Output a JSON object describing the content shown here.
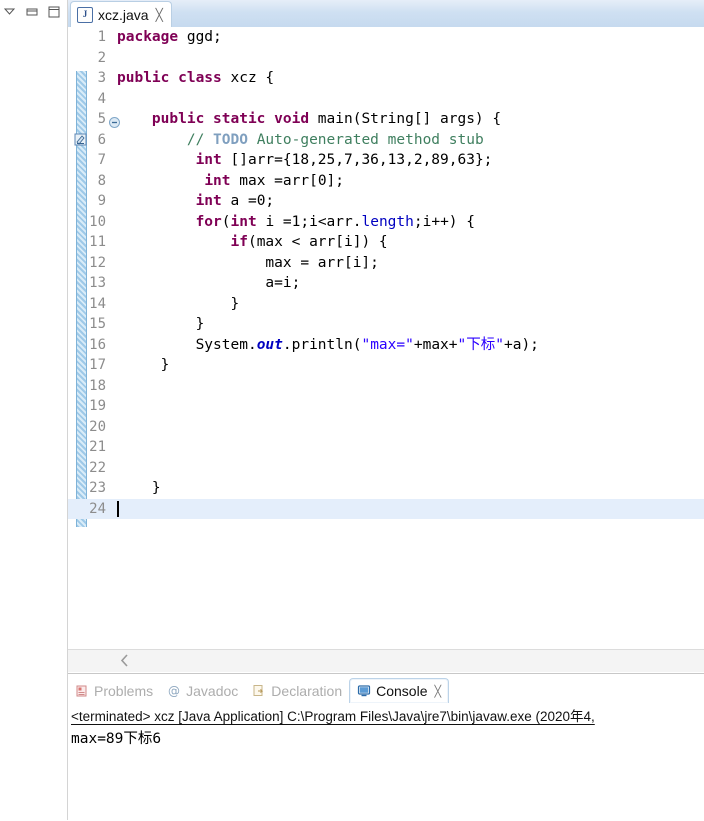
{
  "window": {
    "view_icons": [
      {
        "name": "view-menu-icon",
        "glyph": "chevron-down"
      },
      {
        "name": "minimize-icon",
        "glyph": "minimize"
      },
      {
        "name": "maximize-icon",
        "glyph": "maximize"
      }
    ]
  },
  "editor": {
    "tab": {
      "label": "xcz.java",
      "icon": "java-file-icon",
      "icon_letter": "J",
      "close_glyph": "╳"
    },
    "gutter": {
      "change_bar_color": "#9ec9e8",
      "todo_marker_name": "todo-task-marker-icon"
    },
    "current_line": 24,
    "scrollbar": {
      "left_arrow_glyph": "‹"
    },
    "lines": [
      {
        "n": "1",
        "fold": false,
        "segments": [
          {
            "t": "package ",
            "c": "kw"
          },
          {
            "t": "ggd;",
            "c": "plain"
          }
        ]
      },
      {
        "n": "2",
        "fold": false,
        "segments": []
      },
      {
        "n": "3",
        "fold": false,
        "segments": [
          {
            "t": "public class ",
            "c": "kw"
          },
          {
            "t": "xcz {",
            "c": "plain"
          }
        ]
      },
      {
        "n": "4",
        "fold": false,
        "segments": []
      },
      {
        "n": "5",
        "fold": true,
        "segments": [
          {
            "t": "    ",
            "c": "plain"
          },
          {
            "t": "public static void ",
            "c": "kw"
          },
          {
            "t": "main(String[] args) {",
            "c": "plain"
          }
        ]
      },
      {
        "n": "6",
        "fold": false,
        "segments": [
          {
            "t": "        ",
            "c": "plain"
          },
          {
            "t": "// ",
            "c": "cmt-gray"
          },
          {
            "t": "TODO",
            "c": "cmt-todo"
          },
          {
            "t": " Auto-generated method stub",
            "c": "cmt-gray"
          }
        ]
      },
      {
        "n": "7",
        "fold": false,
        "segments": [
          {
            "t": "         ",
            "c": "plain"
          },
          {
            "t": "int",
            "c": "kw"
          },
          {
            "t": " []arr={18,25,7,36,13,2,89,63};",
            "c": "plain"
          }
        ]
      },
      {
        "n": "8",
        "fold": false,
        "segments": [
          {
            "t": "          ",
            "c": "plain"
          },
          {
            "t": "int",
            "c": "kw"
          },
          {
            "t": " max =arr[0];",
            "c": "plain"
          }
        ]
      },
      {
        "n": "9",
        "fold": false,
        "segments": [
          {
            "t": "         ",
            "c": "plain"
          },
          {
            "t": "int",
            "c": "kw"
          },
          {
            "t": " a =0;",
            "c": "plain"
          }
        ]
      },
      {
        "n": "10",
        "fold": false,
        "segments": [
          {
            "t": "         ",
            "c": "plain"
          },
          {
            "t": "for",
            "c": "kw"
          },
          {
            "t": "(",
            "c": "plain"
          },
          {
            "t": "int",
            "c": "kw"
          },
          {
            "t": " i =1;i<arr.",
            "c": "plain"
          },
          {
            "t": "length",
            "c": "fld"
          },
          {
            "t": ";i++) {",
            "c": "plain"
          }
        ]
      },
      {
        "n": "11",
        "fold": false,
        "segments": [
          {
            "t": "             ",
            "c": "plain"
          },
          {
            "t": "if",
            "c": "kw"
          },
          {
            "t": "(max < arr[i]) {",
            "c": "plain"
          }
        ]
      },
      {
        "n": "12",
        "fold": false,
        "segments": [
          {
            "t": "                 max = arr[i];",
            "c": "plain"
          }
        ]
      },
      {
        "n": "13",
        "fold": false,
        "segments": [
          {
            "t": "                 a=i;",
            "c": "plain"
          }
        ]
      },
      {
        "n": "14",
        "fold": false,
        "segments": [
          {
            "t": "             }",
            "c": "plain"
          }
        ]
      },
      {
        "n": "15",
        "fold": false,
        "segments": [
          {
            "t": "         }",
            "c": "plain"
          }
        ]
      },
      {
        "n": "16",
        "fold": false,
        "segments": [
          {
            "t": "         System.",
            "c": "plain"
          },
          {
            "t": "out",
            "c": "stat"
          },
          {
            "t": ".println(",
            "c": "plain"
          },
          {
            "t": "\"max=\"",
            "c": "str"
          },
          {
            "t": "+max+",
            "c": "plain"
          },
          {
            "t": "\"下标\"",
            "c": "str"
          },
          {
            "t": "+a);",
            "c": "plain"
          }
        ]
      },
      {
        "n": "17",
        "fold": false,
        "segments": [
          {
            "t": "     }",
            "c": "plain"
          }
        ]
      },
      {
        "n": "18",
        "fold": false,
        "segments": []
      },
      {
        "n": "19",
        "fold": false,
        "segments": []
      },
      {
        "n": "20",
        "fold": false,
        "segments": []
      },
      {
        "n": "21",
        "fold": false,
        "segments": []
      },
      {
        "n": "22",
        "fold": false,
        "segments": []
      },
      {
        "n": "23",
        "fold": false,
        "segments": [
          {
            "t": "    }",
            "c": "plain"
          }
        ]
      },
      {
        "n": "24",
        "fold": false,
        "segments": []
      }
    ]
  },
  "console_panel": {
    "tabs": [
      {
        "label": "Problems",
        "icon": "problems-icon",
        "active": false
      },
      {
        "label": "Javadoc",
        "icon": "javadoc-icon",
        "active": false
      },
      {
        "label": "Declaration",
        "icon": "declaration-icon",
        "active": false
      },
      {
        "label": "Console",
        "icon": "console-icon",
        "active": true
      }
    ],
    "close_glyph": "╳",
    "terminated_line": "<terminated> xcz [Java Application] C:\\Program Files\\Java\\jre7\\bin\\javaw.exe (2020年4,",
    "output": "max=89下标6"
  }
}
